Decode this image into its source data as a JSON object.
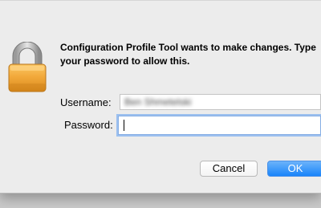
{
  "dialog": {
    "message": "Configuration Profile Tool wants to make changes. Type your password to allow this.",
    "username_label": "Username:",
    "username_value": "Ben Shmetelski",
    "password_label": "Password:",
    "password_value": "",
    "cancel_label": "Cancel",
    "ok_label": "OK"
  },
  "icons": {
    "lock": "lock-icon"
  },
  "colors": {
    "dialog_background": "#ececec",
    "default_button": "#1984fa",
    "focus_ring": "#9cc0ef",
    "lock_gold": "#f2a93b"
  }
}
